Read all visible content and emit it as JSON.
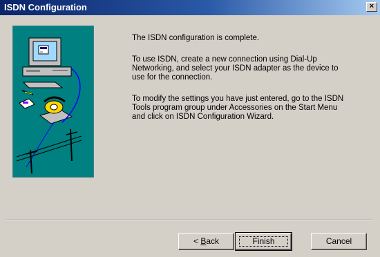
{
  "window": {
    "title": "ISDN Configuration",
    "close_glyph": "×"
  },
  "content": {
    "para1": "The ISDN configuration is complete.",
    "para2_line1": "To use ISDN, create a new connection using Dial-Up",
    "para2_line2": "Networking, and select your ISDN adapter as the device to",
    "para2_line3": "use for the connection.",
    "para3_line1": "To modify the settings you have just entered, go to the ISDN",
    "para3_line2": "Tools program group under Accessories on the Start Menu",
    "para3_line3": "and click on ISDN Configuration Wizard."
  },
  "buttons": {
    "back_prefix": "< ",
    "back_accel": "B",
    "back_rest": "ack",
    "finish": "Finish",
    "cancel": "Cancel"
  },
  "illustration": {
    "icons": [
      "computer-icon",
      "telephone-icon",
      "notepad-icon",
      "utility-pole-icon"
    ],
    "background_color": "#008080"
  }
}
